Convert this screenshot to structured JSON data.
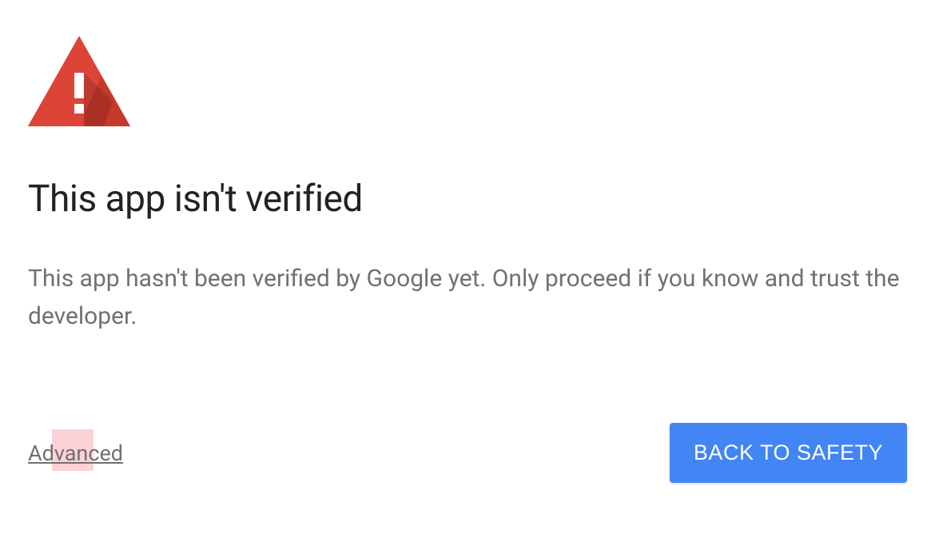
{
  "heading": "This app isn't verified",
  "description": "This app hasn't been verified by Google yet. Only proceed if you know and trust the developer.",
  "actions": {
    "advanced_label": "Advanced",
    "safety_button_label": "BACK TO SAFETY"
  },
  "colors": {
    "warning_red": "#db4437",
    "button_blue": "#4285f4"
  }
}
